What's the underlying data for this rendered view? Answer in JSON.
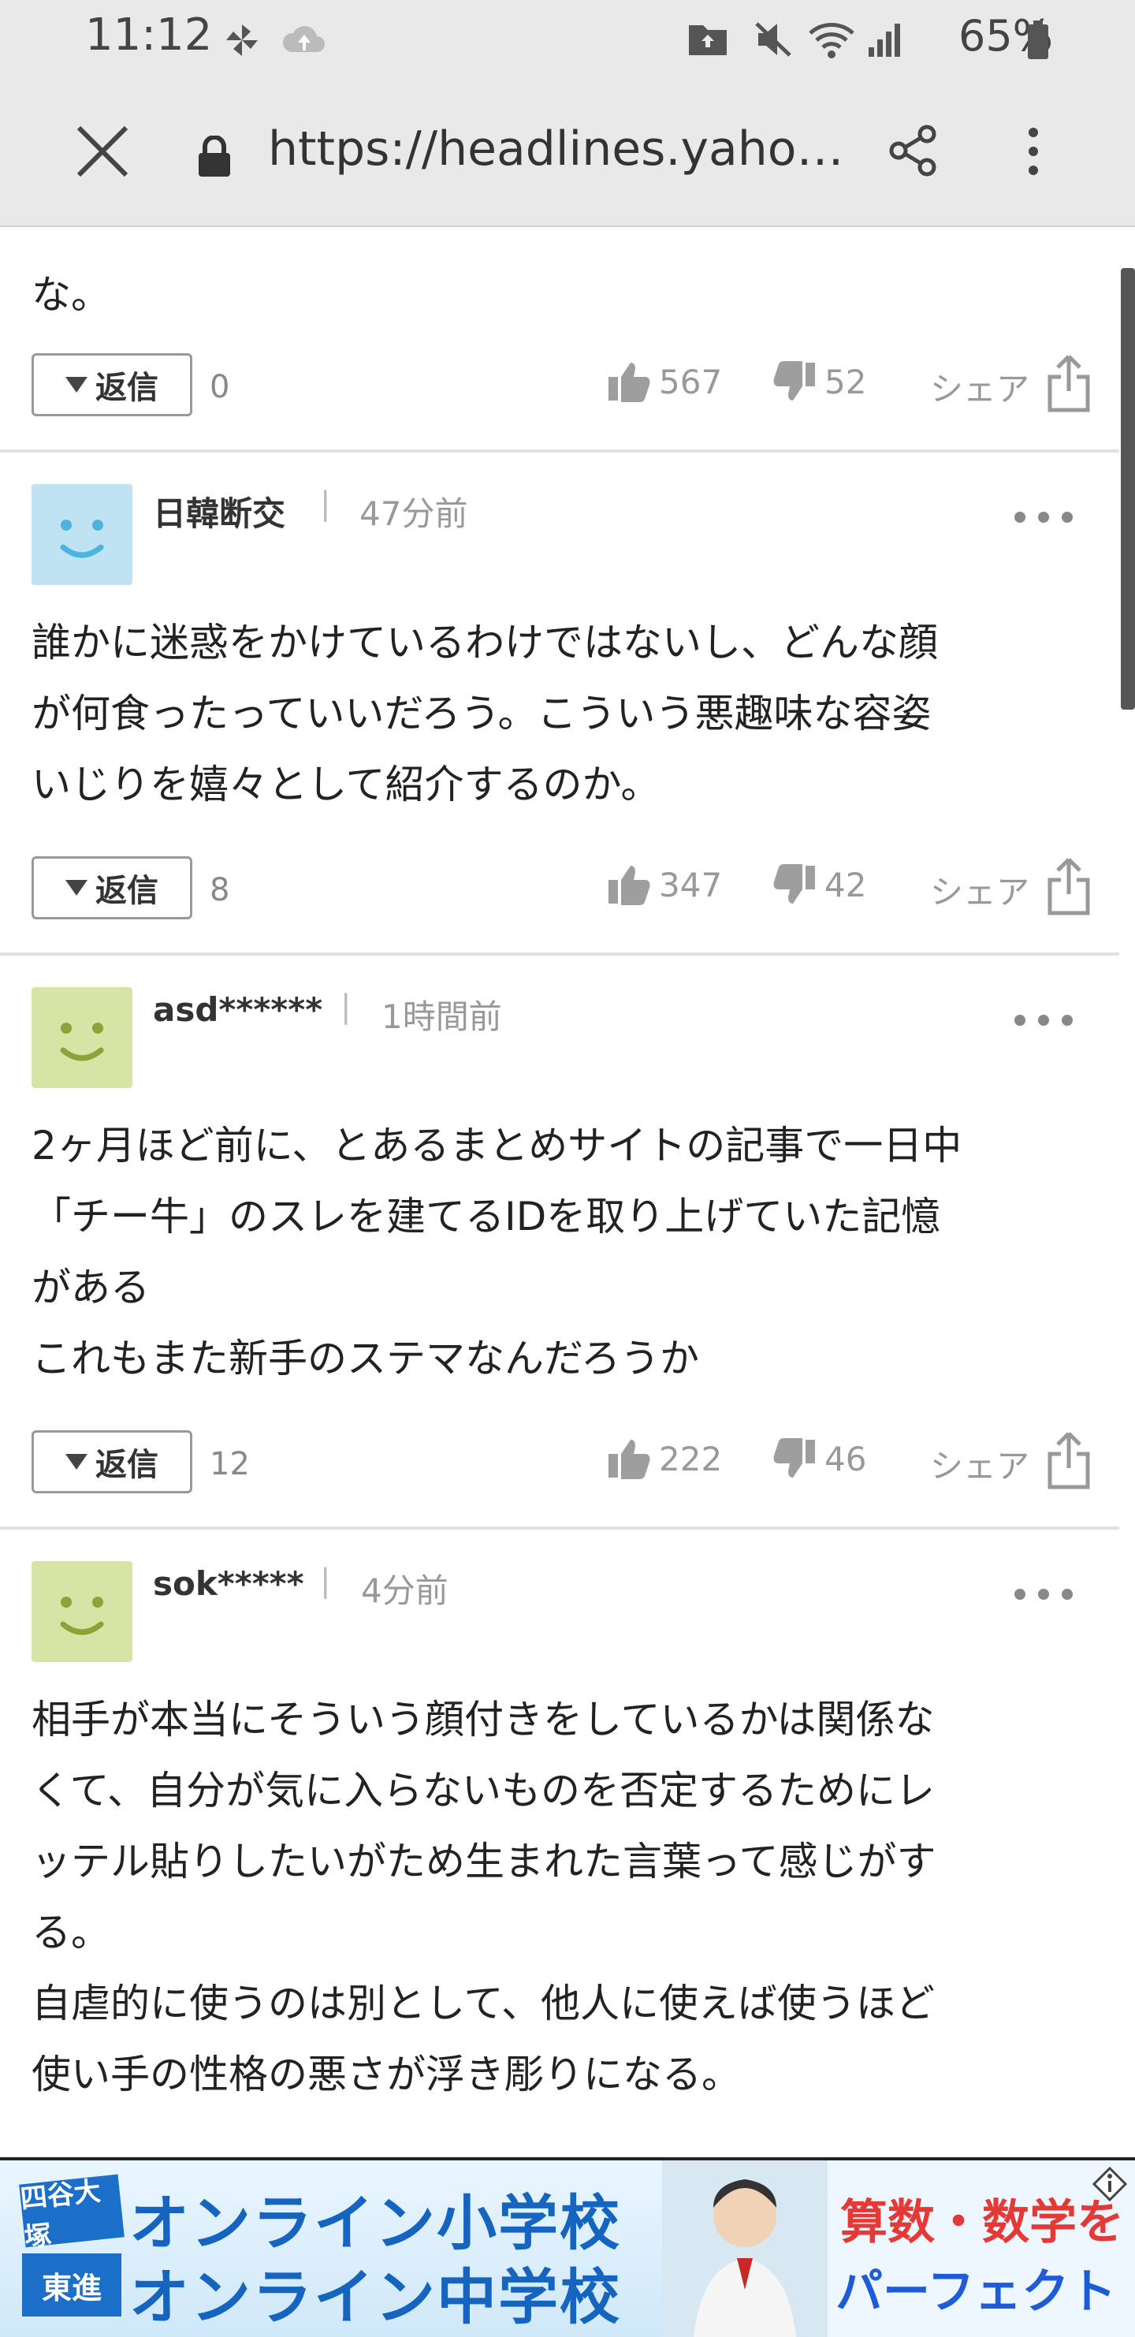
{
  "status_bar": {
    "time": "11:12",
    "battery": "65%"
  },
  "browser": {
    "url": "https://headlines.yahoo.co..."
  },
  "partial_comment": {
    "text": "な。",
    "reply_label": "返信",
    "reply_count": "0",
    "likes": "567",
    "dislikes": "52",
    "share_label": "シェア"
  },
  "comments": [
    {
      "username": "日韓断交",
      "time_ago": "47分前",
      "avatar_color": "#bfe3f3",
      "face_color": "#4fb3e0",
      "text": "誰かに迷惑をかけているわけではないし、どんな顔\nが何食ったっていいだろう。こういう悪趣味な容姿\nいじりを嬉々として紹介するのか。",
      "reply_label": "返信",
      "reply_count": "8",
      "likes": "347",
      "dislikes": "42",
      "share_label": "シェア"
    },
    {
      "username": "asd******",
      "time_ago": "1時間前",
      "avatar_color": "#d6e4a6",
      "face_color": "#8aa43a",
      "text": "2ヶ月ほど前に、とあるまとめサイトの記事で一日中\n「チー牛」のスレを建てるIDを取り上げていた記憶\nがある\nこれもまた新手のステマなんだろうか",
      "reply_label": "返信",
      "reply_count": "12",
      "likes": "222",
      "dislikes": "46",
      "share_label": "シェア"
    },
    {
      "username": "sok*****",
      "time_ago": "4分前",
      "avatar_color": "#d6e4a6",
      "face_color": "#8aa43a",
      "text": "相手が本当にそういう顔付きをしているかは関係な\nくて、自分が気に入らないものを否定するためにレ\nッテル貼りしたいがため生まれた言葉って感じがす\nる。\n自虐的に使うのは別として、他人に使えば使うほど\n使い手の性格の悪さが浮き彫りになる。"
    }
  ],
  "ad": {
    "badge_top": "四谷大塚",
    "badge_bottom": "東進",
    "line1": "オンライン小学校",
    "line2": "オンライン中学校",
    "right1": "算数・数学を",
    "right2": "パーフェクトに!"
  }
}
